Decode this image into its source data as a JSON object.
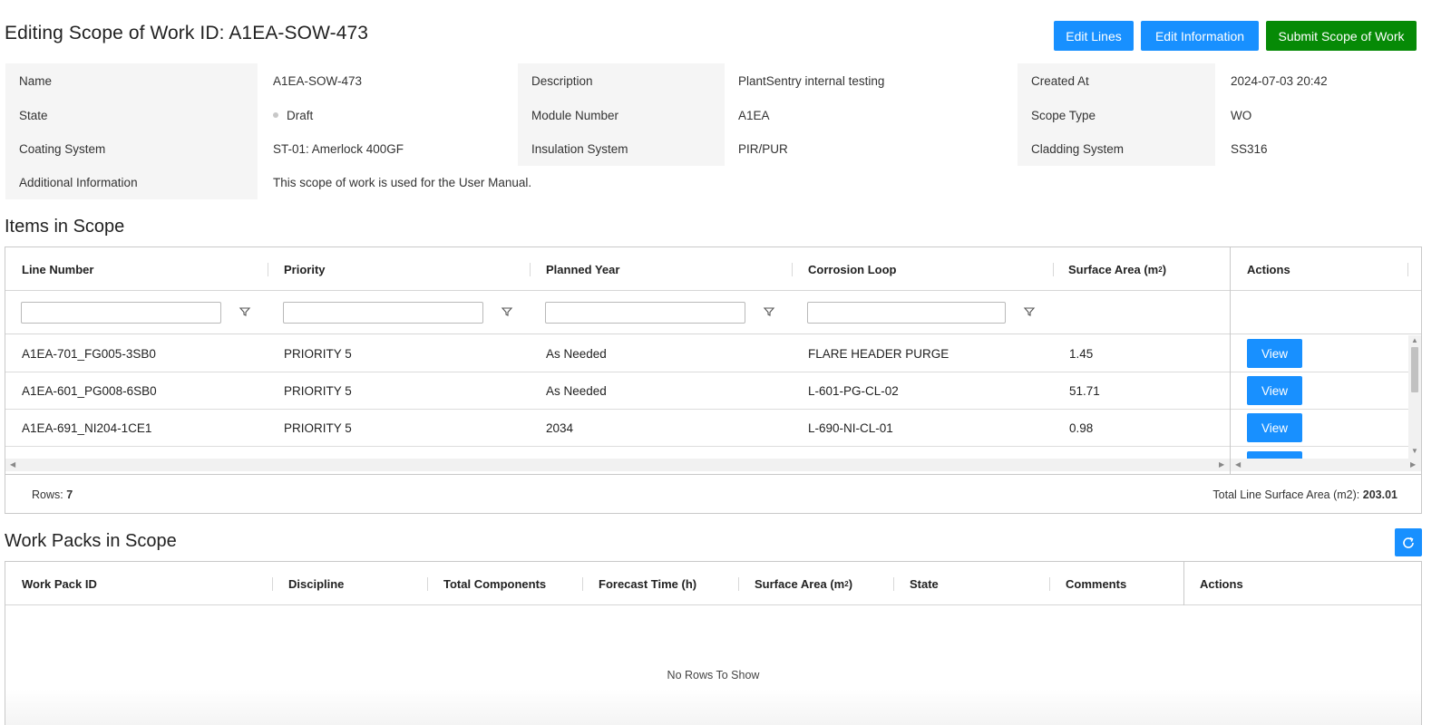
{
  "header": {
    "title": "Editing Scope of Work ID: A1EA-SOW-473",
    "edit_lines_label": "Edit Lines",
    "edit_information_label": "Edit Information",
    "submit_label": "Submit Scope of Work"
  },
  "info": {
    "name_label": "Name",
    "name_value": "A1EA-SOW-473",
    "description_label": "Description",
    "description_value": "PlantSentry internal testing",
    "created_label": "Created At",
    "created_value": "2024-07-03 20:42",
    "state_label": "State",
    "state_value": "Draft",
    "module_label": "Module Number",
    "module_value": "A1EA",
    "scope_type_label": "Scope Type",
    "scope_type_value": "WO",
    "coating_label": "Coating System",
    "coating_value": "ST-01: Amerlock 400GF",
    "insulation_label": "Insulation System",
    "insulation_value": "PIR/PUR",
    "cladding_label": "Cladding System",
    "cladding_value": "SS316",
    "additional_label": "Additional Information",
    "additional_value": "This scope of work is used for the User Manual."
  },
  "items": {
    "title": "Items in Scope",
    "columns": {
      "line_number": "Line Number",
      "priority": "Priority",
      "planned_year": "Planned Year",
      "corrosion_loop": "Corrosion Loop",
      "surface_area": "Surface Area (m",
      "surface_area_sup": "2",
      "surface_area_close": ")",
      "actions": "Actions"
    },
    "rows": [
      {
        "line_number": "A1EA-701_FG005-3SB0",
        "priority": "PRIORITY 5",
        "planned_year": "As Needed",
        "corrosion_loop": "FLARE HEADER PURGE",
        "surface_area": "1.45",
        "action": "View"
      },
      {
        "line_number": "A1EA-601_PG008-6SB0",
        "priority": "PRIORITY 5",
        "planned_year": "As Needed",
        "corrosion_loop": "L-601-PG-CL-02",
        "surface_area": "51.71",
        "action": "View"
      },
      {
        "line_number": "A1EA-691_NI204-1CE1",
        "priority": "PRIORITY 5",
        "planned_year": "2034",
        "corrosion_loop": "L-690-NI-CL-01",
        "surface_area": "0.98",
        "action": "View"
      }
    ],
    "rows_label": "Rows:",
    "rows_count": "7",
    "total_label": "Total Line Surface Area (m2):",
    "total_value": "203.01"
  },
  "work_packs": {
    "title": "Work Packs in Scope",
    "columns": {
      "work_pack_id": "Work Pack ID",
      "discipline": "Discipline",
      "total_components": "Total Components",
      "forecast_time": "Forecast Time (h)",
      "surface_area": "Surface Area (m",
      "surface_area_sup": "2",
      "surface_area_close": ")",
      "state": "State",
      "comments": "Comments",
      "actions": "Actions"
    },
    "empty_text": "No Rows To Show"
  },
  "icons": {
    "filter": "filter-icon",
    "refresh": "refresh-icon",
    "state_dot": "status-dot-icon"
  },
  "colors": {
    "primary": "#1890ff",
    "success": "#068a06",
    "label_bg": "#f5f5f5"
  }
}
